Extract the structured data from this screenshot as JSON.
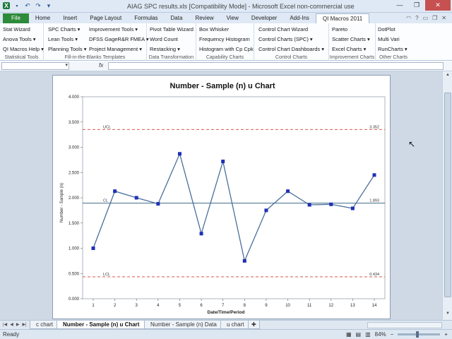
{
  "window": {
    "title": "AIAG SPC results.xls  [Compatibility Mode]  -  Microsoft Excel non-commercial use",
    "minimize": "—",
    "restore": "❐",
    "close": "✕"
  },
  "qat": {
    "logo": "X",
    "save": "▪",
    "undo": "↶",
    "redo": "↷",
    "more": "▾"
  },
  "tabs": [
    "File",
    "Home",
    "Insert",
    "Page Layout",
    "Formulas",
    "Data",
    "Review",
    "View",
    "Developer",
    "Add-Ins",
    "QI Macros 2011"
  ],
  "tab_icons": [
    "◠",
    "?",
    "▭",
    "❐",
    "✕"
  ],
  "ribbon": {
    "statistical_tools": {
      "items": [
        "Stat Wizard",
        "Anova Tools ▾",
        "QI Macros Help ▾"
      ],
      "label": "Statistical Tools"
    },
    "fill_in_blanks": {
      "col1": [
        "SPC Charts ▾",
        "Lean Tools ▾",
        "Planning Tools ▾"
      ],
      "col2": [
        "Improvement Tools ▾",
        "DFSS GageR&R FMEA ▾",
        "Project Management ▾"
      ],
      "label": "Fill-in-the-Blanks Templates"
    },
    "data_transformation": {
      "items": [
        "Pivot Table Wizard",
        "Word Count",
        "Restacking ▾"
      ],
      "label": "Data Transformation"
    },
    "capability_charts": {
      "items": [
        "Box Whisker",
        "Frequency Histogram",
        "Histogram with Cp Cpk"
      ],
      "label": "Capability Charts"
    },
    "control_charts": {
      "items": [
        "Control Chart Wizard",
        "Control Charts (SPC) ▾",
        "Control Chart Dashboards ▾"
      ],
      "label": "Control Charts"
    },
    "improvement_charts": {
      "items": [
        "Pareto",
        "Scatter Charts ▾",
        "Excel Charts ▾"
      ],
      "label": "Improvement Charts"
    },
    "other_charts": {
      "items": [
        "DotPlot",
        "Multi Vari",
        "RunCharts ▾"
      ],
      "label": "Other Charts"
    }
  },
  "formula_bar": {
    "fx": "fx"
  },
  "sheet_tabs": [
    "c chart",
    "Number - Sample (n) u Chart",
    "Number - Sample (n) Data",
    "u chart"
  ],
  "status": {
    "left": "Ready",
    "zoom": "84%",
    "minus": "−",
    "plus": "+"
  },
  "colors": {
    "data_line": "#4a6f9a",
    "marker": "#1f2fb8",
    "center_line": "#3d6b8c",
    "control_limit": "#d2413a"
  },
  "chart_data": {
    "type": "line",
    "title": "Number - Sample (n) u Chart",
    "xlabel": "Date/Time/Period",
    "ylabel": "Number - Sample (n)",
    "categories": [
      1,
      2,
      3,
      4,
      5,
      6,
      7,
      8,
      9,
      10,
      11,
      12,
      13,
      14
    ],
    "series": [
      {
        "values": [
          1.0,
          2.13,
          2.0,
          1.88,
          2.87,
          1.29,
          2.72,
          0.75,
          1.75,
          2.13,
          1.86,
          1.87,
          1.79,
          2.45
        ]
      }
    ],
    "ylim": [
      0,
      4
    ],
    "yticks": [
      "0.000",
      "0.500",
      "1.000",
      "1.500",
      "2.000",
      "2.500",
      "3.000",
      "3.500",
      "4.000"
    ],
    "lines": {
      "ucl": {
        "label": "UCL",
        "value": 3.352,
        "value_label": "3.352"
      },
      "cl": {
        "label": "CL",
        "value": 1.893,
        "value_label": "1.893"
      },
      "lcl": {
        "label": "LCL",
        "value": 0.434,
        "value_label": "0.434"
      }
    },
    "grid": false,
    "legend": "none"
  }
}
